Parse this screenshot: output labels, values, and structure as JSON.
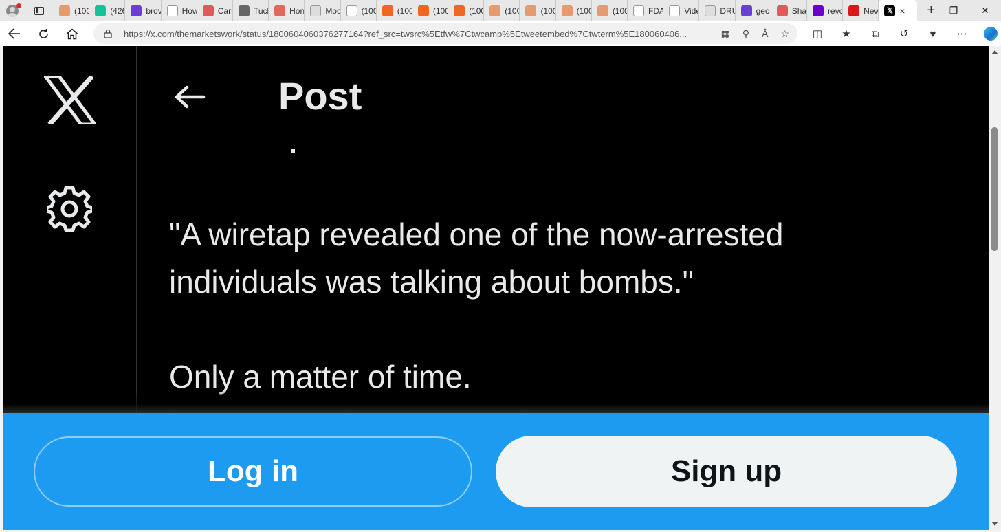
{
  "browser": {
    "tabs": [
      {
        "label": "(100",
        "icon": "substack-icon",
        "color": "#e59b6d"
      },
      {
        "label": "(426",
        "icon": "grammarly-icon",
        "color": "#15c39a"
      },
      {
        "label": "brov",
        "icon": "yahoo-icon",
        "color": "#6b3fd6"
      },
      {
        "label": "How",
        "icon": "page-icon",
        "color": "#ffffff"
      },
      {
        "label": "Carl",
        "icon": "youtube-icon",
        "color": "#e05a5a"
      },
      {
        "label": "Tuck",
        "icon": "x-icon",
        "color": "#666666"
      },
      {
        "label": "Hon",
        "icon": "podcast-icon",
        "color": "#e06a5a"
      },
      {
        "label": "Moc",
        "icon": "font-icon",
        "color": "#dddddd"
      },
      {
        "label": "(100",
        "icon": "page-icon",
        "color": "#ffffff"
      },
      {
        "label": "(100",
        "icon": "substack-icon",
        "color": "#f26522"
      },
      {
        "label": "(100",
        "icon": "substack-icon",
        "color": "#f26522"
      },
      {
        "label": "(100",
        "icon": "substack-icon",
        "color": "#f26522"
      },
      {
        "label": "(100",
        "icon": "substack-icon",
        "color": "#e59b6d"
      },
      {
        "label": "(100",
        "icon": "substack-icon",
        "color": "#e59b6d"
      },
      {
        "label": "(100",
        "icon": "substack-icon",
        "color": "#e59b6d"
      },
      {
        "label": "(100",
        "icon": "substack-icon",
        "color": "#e59b6d"
      },
      {
        "label": "FDA",
        "icon": "page-icon",
        "color": "#ffffff"
      },
      {
        "label": "Vide",
        "icon": "star-icon",
        "color": "#ffffff"
      },
      {
        "label": "DRU",
        "icon": "drudge-icon",
        "color": "#dddddd"
      },
      {
        "label": "geo",
        "icon": "yahoo-icon",
        "color": "#6b3fd6"
      },
      {
        "label": "Sha",
        "icon": "youtube-icon",
        "color": "#e05a5a"
      },
      {
        "label": "revo",
        "icon": "yahoo-icon",
        "color": "#6b00c9"
      },
      {
        "label": "New",
        "icon": "r-icon",
        "color": "#d7191c"
      }
    ],
    "active_tab_close": "×",
    "url": "https://x.com/themarketswork/status/1800604060376277164?ref_src=twsrc%5Etfw%7Ctwcamp%5Etweetembed%7Ctwterm%5E180060406..."
  },
  "page": {
    "header_title": "Post",
    "tweet_lines": [
      "\"A wiretap revealed one of the now-arrested",
      "individuals was talking about bombs.\"",
      "",
      "Only a matter of time."
    ],
    "login_label": "Log in",
    "signup_label": "Sign up",
    "colors": {
      "background": "#000000",
      "text": "#e7e9ea",
      "accent": "#1d9bf0",
      "signup_bg": "#eff3f4"
    }
  }
}
